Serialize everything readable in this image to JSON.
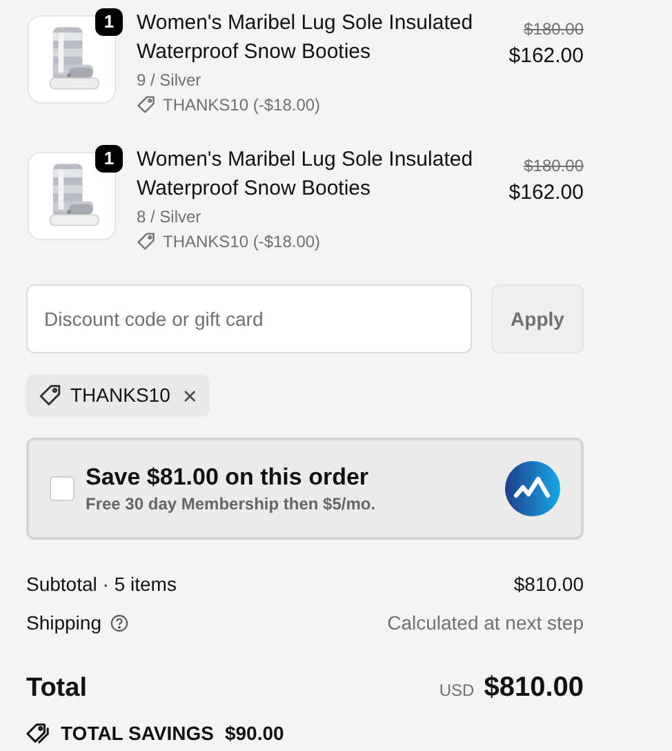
{
  "items": [
    {
      "quantity": "1",
      "title": "Women's Maribel Lug Sole Insulated Waterproof Snow Booties",
      "variant": "9 / Silver",
      "discount": "THANKS10 (-$18.00)",
      "original_price": "$180.00",
      "price": "$162.00"
    },
    {
      "quantity": "1",
      "title": "Women's Maribel Lug Sole Insulated Waterproof Snow Booties",
      "variant": "8 / Silver",
      "discount": "THANKS10 (-$18.00)",
      "original_price": "$180.00",
      "price": "$162.00"
    }
  ],
  "discount_field": {
    "placeholder": "Discount code or gift card"
  },
  "apply_button": "Apply",
  "applied_codes": [
    {
      "code": "THANKS10",
      "remove": "×"
    }
  ],
  "membership_offer": {
    "checked": false,
    "title": "Save $81.00 on this order",
    "subtitle": "Free 30 day Membership then $5/mo."
  },
  "summary": [
    {
      "label": "Subtotal · 5 items",
      "value": "$810.00",
      "kind": "amount"
    },
    {
      "label": "Shipping",
      "value": "Calculated at next step",
      "kind": "note"
    }
  ],
  "total": {
    "label": "Total",
    "currency": "USD",
    "amount": "$810.00"
  },
  "savings": {
    "label": "TOTAL SAVINGS",
    "amount": "$90.00"
  }
}
